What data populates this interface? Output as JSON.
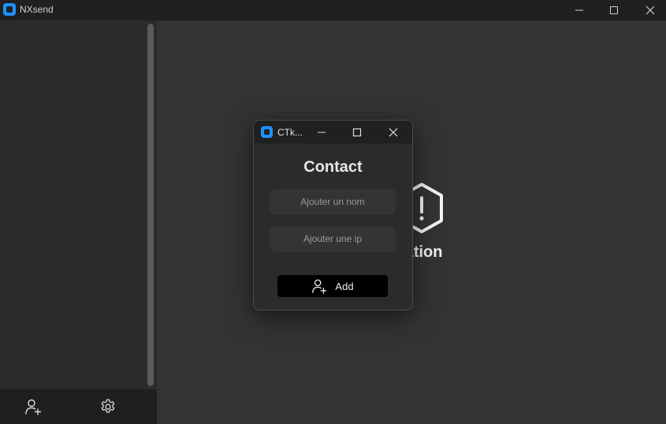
{
  "app": {
    "title": "NXsend",
    "accent_color": "#1e90ff"
  },
  "window_controls": {
    "minimize_icon": "minimize-icon",
    "maximize_icon": "maximize-icon",
    "close_icon": "close-icon"
  },
  "sidebar": {
    "footer": {
      "add_contact_icon": "add-user-icon",
      "settings_icon": "gear-icon"
    }
  },
  "main": {
    "empty_state_text": "conversation",
    "empty_state_icon": "hexagon-alert-icon"
  },
  "dialog": {
    "window_title": "CTk...",
    "heading": "Contact",
    "name_placeholder": "Ajouter un nom",
    "ip_placeholder": "Ajouter une ip",
    "add_button_label": "Add",
    "add_button_icon": "add-user-icon"
  }
}
